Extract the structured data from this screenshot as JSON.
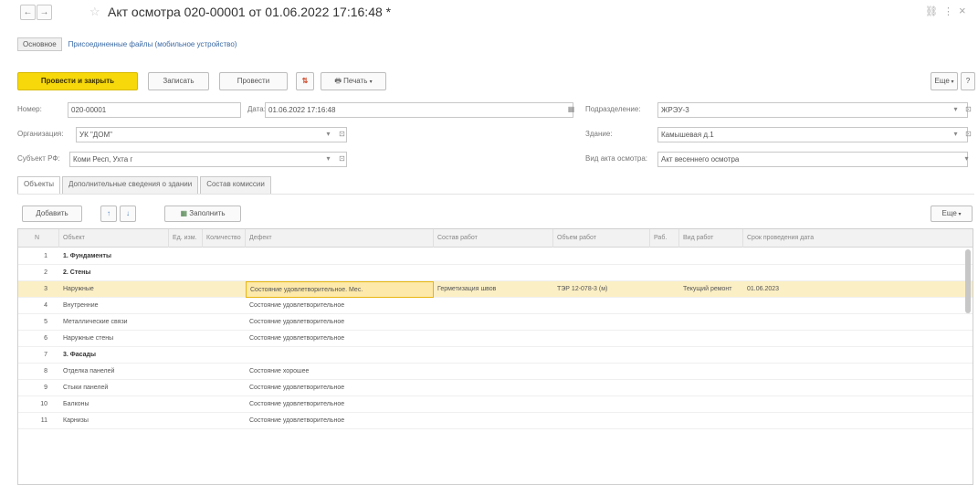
{
  "window": {
    "title": "Акт осмотра 020-00001 от 01.06.2022 17:16:48 *",
    "back_icon": "←",
    "forward_icon": "→",
    "star_icon": "☆",
    "link_icon": "🔗",
    "more_icon": "⋮",
    "close_icon": "×"
  },
  "form_tabs": {
    "main": "Основное",
    "attached": "Присоединенные файлы (мобильное устройство)"
  },
  "toolbar": {
    "post_close": "Провести и закрыть",
    "save": "Записать",
    "post": "Провести",
    "print": "Печать",
    "more": "Еще",
    "help": "?"
  },
  "fields": {
    "number_label": "Номер:",
    "number_value": "020-00001",
    "date_label": "Дата:",
    "date_value": "01.06.2022 17:16:48",
    "division_label": "Подразделение:",
    "division_value": "ЖРЭУ-3",
    "org_label": "Организация:",
    "org_value": "УК \"ДОМ\"",
    "building_label": "Здание:",
    "building_value": "Камышевая д.1",
    "subject_label": "Субъект РФ:",
    "subject_value": "Коми Респ, Ухта г",
    "act_type_label": "Вид акта осмотра:",
    "act_type_value": "Акт весеннего осмотра"
  },
  "inner_tabs": [
    "Объекты",
    "Дополнительные сведения о здании",
    "Состав комиссии"
  ],
  "table_toolbar": {
    "add": "Добавить",
    "up": "↑",
    "down": "↓",
    "fill": "Заполнить",
    "more": "Еще"
  },
  "table": {
    "columns": [
      "N",
      "Объект",
      "Ед. изм.",
      "Количество",
      "Дефект",
      "Состав работ",
      "Объем работ",
      "Раб.",
      "Вид работ",
      "Срок проведения дата"
    ],
    "rows": [
      {
        "n": "1",
        "object": "1. Фундаменты",
        "defect": "",
        "works": "",
        "volume": "",
        "kind": "",
        "date": "",
        "group": true
      },
      {
        "n": "2",
        "object": "2. Стены",
        "defect": "",
        "works": "",
        "volume": "",
        "kind": "",
        "date": "",
        "group": true
      },
      {
        "n": "3",
        "object": "Наружные",
        "defect": "Состояние удовлетворительное. Мес.",
        "works": "Герметизация швов",
        "volume": "ТЭР 12-078-3 (м)",
        "kind": "Текущий ремонт",
        "date": "01.06.2023",
        "group": false
      },
      {
        "n": "4",
        "object": "Внутренние",
        "defect": "Состояние удовлетворительное",
        "works": "",
        "volume": "",
        "kind": "",
        "date": "",
        "group": false
      },
      {
        "n": "5",
        "object": "Металлические связи",
        "defect": "Состояние удовлетворительное",
        "works": "",
        "volume": "",
        "kind": "",
        "date": "",
        "group": false
      },
      {
        "n": "6",
        "object": "Наружные стены",
        "defect": "Состояние удовлетворительное",
        "works": "",
        "volume": "",
        "kind": "",
        "date": "",
        "group": false
      },
      {
        "n": "7",
        "object": "3. Фасады",
        "defect": "",
        "works": "",
        "volume": "",
        "kind": "",
        "date": "",
        "group": true
      },
      {
        "n": "8",
        "object": "Отделка панелей",
        "defect": "Состояние хорошее",
        "works": "",
        "volume": "",
        "kind": "",
        "date": "",
        "group": false
      },
      {
        "n": "9",
        "object": "Стыки панелей",
        "defect": "Состояние удовлетворительное",
        "works": "",
        "volume": "",
        "kind": "",
        "date": "",
        "group": false
      },
      {
        "n": "10",
        "object": "Балконы",
        "defect": "Состояние удовлетворительное",
        "works": "",
        "volume": "",
        "kind": "",
        "date": "",
        "group": false
      },
      {
        "n": "11",
        "object": "Карнизы",
        "defect": "Состояние удовлетворительное",
        "works": "",
        "volume": "",
        "kind": "",
        "date": "",
        "group": false
      }
    ]
  },
  "colors": {
    "accent_yellow": "#f6d80b",
    "selected_row": "#fbefc5",
    "link_blue": "#3a6aa5"
  }
}
